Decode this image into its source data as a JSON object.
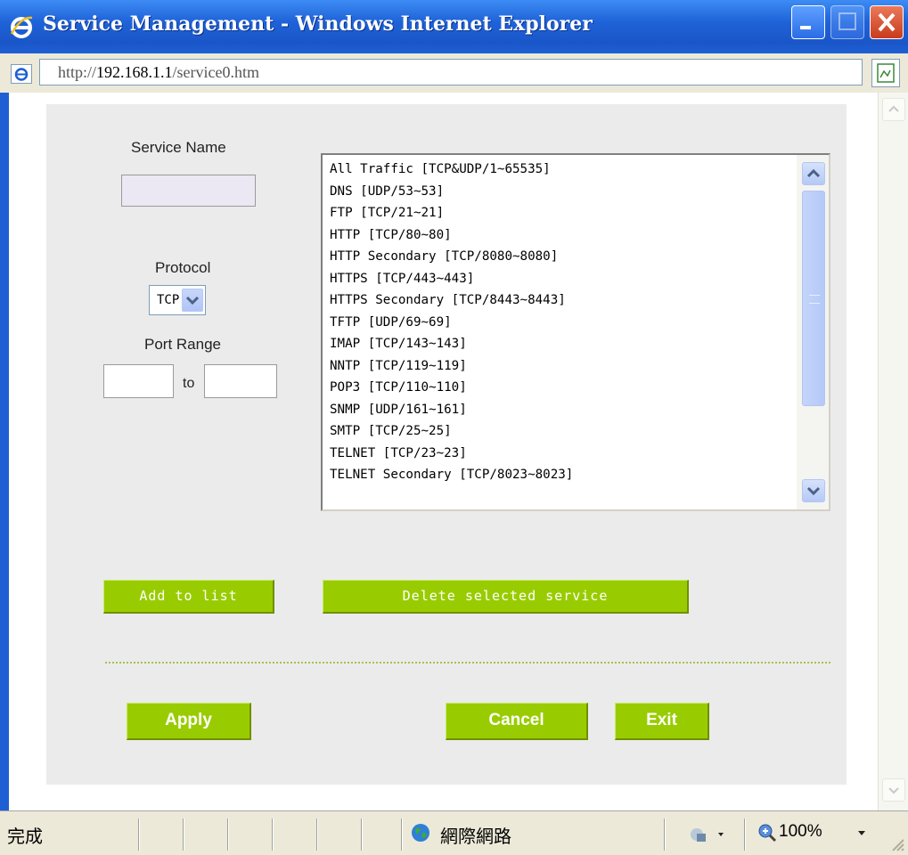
{
  "window": {
    "title": "Service Management - Windows Internet Explorer",
    "controls": [
      "minimize",
      "maximize",
      "close"
    ]
  },
  "address_bar": {
    "url_prefix": "http://",
    "url_host": "192.168.1.1",
    "url_path": "/service0.htm"
  },
  "form": {
    "service_name_label": "Service Name",
    "service_name_value": "",
    "protocol_label": "Protocol",
    "protocol_value": "TCP",
    "port_range_label": "Port Range",
    "port_from": "",
    "port_to_label": "to",
    "port_to": ""
  },
  "service_list": [
    "All Traffic [TCP&UDP/1~65535]",
    "DNS [UDP/53~53]",
    "FTP [TCP/21~21]",
    "HTTP [TCP/80~80]",
    "HTTP Secondary [TCP/8080~8080]",
    "HTTPS [TCP/443~443]",
    "HTTPS Secondary [TCP/8443~8443]",
    "TFTP [UDP/69~69]",
    "IMAP [TCP/143~143]",
    "NNTP [TCP/119~119]",
    "POP3 [TCP/110~110]",
    "SNMP [UDP/161~161]",
    "SMTP [TCP/25~25]",
    "TELNET [TCP/23~23]",
    "TELNET Secondary [TCP/8023~8023]"
  ],
  "buttons": {
    "add_to_list": "Add to list",
    "delete_selected": "Delete selected service",
    "apply": "Apply",
    "cancel": "Cancel",
    "exit": "Exit"
  },
  "status_bar": {
    "status": "完成",
    "zone": "網際網路",
    "zoom": "100%"
  },
  "colors": {
    "button_green": "#99cc00",
    "panel_gray": "#ebebeb",
    "title_blue": "#1f63d8"
  }
}
